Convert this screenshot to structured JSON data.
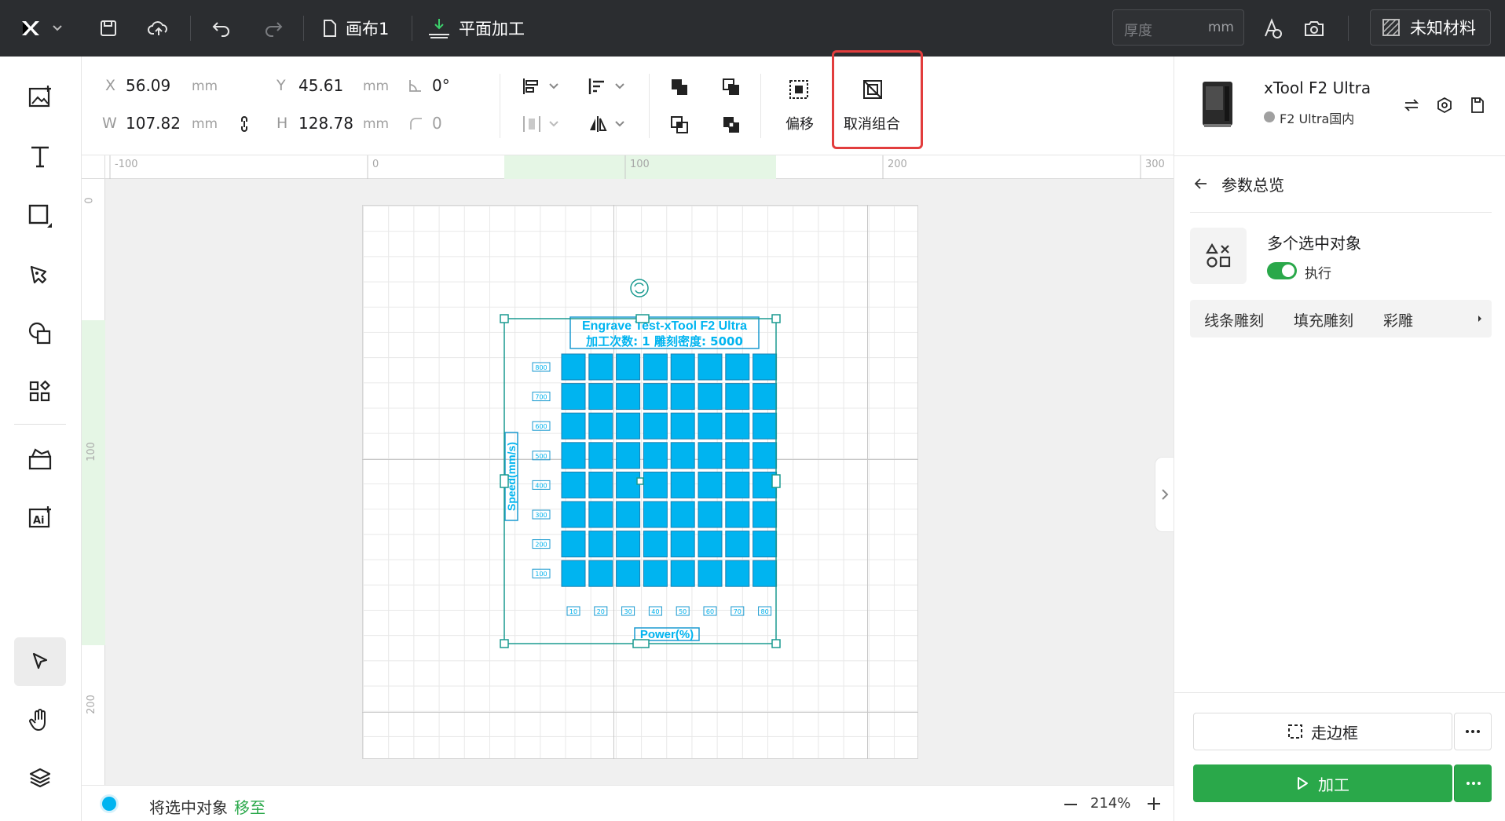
{
  "topbar": {
    "canvas_name": "画布1",
    "mode": "平面加工",
    "thickness_placeholder": "厚度",
    "thickness_unit": "mm",
    "material": "未知材料"
  },
  "props": {
    "x_label": "X",
    "x_value": "56.09",
    "x_unit": "mm",
    "y_label": "Y",
    "y_value": "45.61",
    "y_unit": "mm",
    "angle_value": "0°",
    "w_label": "W",
    "w_value": "107.82",
    "w_unit": "mm",
    "h_label": "H",
    "h_value": "128.78",
    "h_unit": "mm",
    "radius_value": "0",
    "offset_label": "偏移",
    "ungroup_label": "取消组合"
  },
  "ruler": {
    "h_ticks": [
      "-100",
      "0",
      "100",
      "200",
      "300"
    ],
    "v_ticks": [
      "0",
      "100",
      "200"
    ]
  },
  "design": {
    "title_line1": "Engrave Test-xTool F2 Ultra",
    "title_line2": "加工次数: 1 雕刻密度: 5000",
    "y_axis_label": "Speed(mm/s)",
    "x_axis_label": "Power(%)",
    "speed_labels": [
      "800",
      "700",
      "600",
      "500",
      "400",
      "300",
      "200",
      "100"
    ],
    "power_labels": [
      "10",
      "20",
      "30",
      "40",
      "50",
      "60",
      "70",
      "80"
    ],
    "grid_color": "#00b4f0"
  },
  "status": {
    "message": "将选中对象",
    "link": "移至",
    "zoom": "214%"
  },
  "right": {
    "device_name": "xTool F2 Ultra",
    "device_sub": "F2 Ultra国内",
    "panel_title": "参数总览",
    "multi_label": "多个选中对象",
    "toggle_label": "执行",
    "tabs": [
      "线条雕刻",
      "填充雕刻",
      "彩雕"
    ],
    "frame_button": "走边框",
    "process_button": "加工"
  },
  "colors": {
    "accent_green": "#2aa84a",
    "highlight_red": "#e23d3d",
    "selection_teal": "#1a9a90"
  }
}
